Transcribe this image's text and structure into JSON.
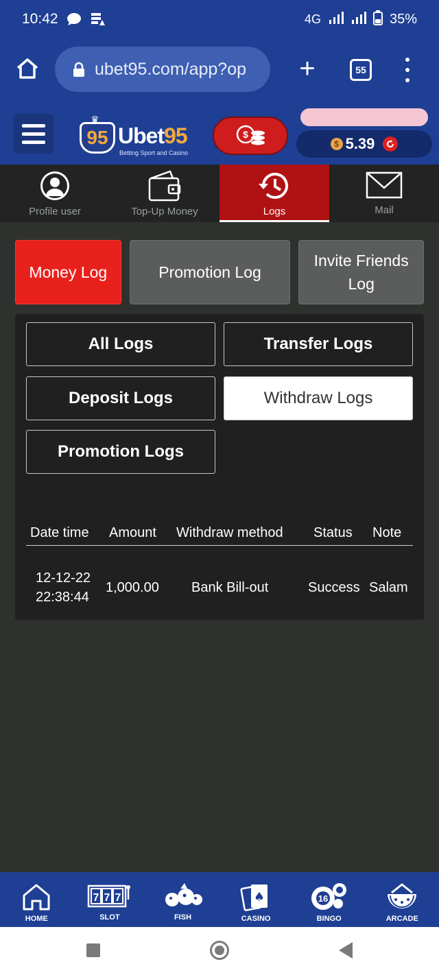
{
  "status_bar": {
    "time": "10:42",
    "network": "4G",
    "battery": "35%"
  },
  "browser": {
    "url": "ubet95.com/app?op",
    "tab_count": "55"
  },
  "header": {
    "logo_badge": "95",
    "logo_name_a": "Ubet",
    "logo_name_b": "95",
    "logo_tagline": "Betting Sport and Casino",
    "balance": "5.39",
    "currency_symbol": "$"
  },
  "account_nav": [
    {
      "label": "Profile user",
      "icon": "profile-icon"
    },
    {
      "label": "Top-Up Money",
      "icon": "wallet-icon"
    },
    {
      "label": "Logs",
      "icon": "history-icon",
      "active": true
    },
    {
      "label": "Mail",
      "icon": "mail-icon"
    }
  ],
  "log_types": [
    {
      "label": "Money Log",
      "active": true
    },
    {
      "label": "Promotion Log"
    },
    {
      "label": "Invite Friends Log"
    }
  ],
  "filters": [
    {
      "label": "All Logs"
    },
    {
      "label": "Transfer Logs"
    },
    {
      "label": "Deposit Logs"
    },
    {
      "label": "Withdraw Logs",
      "active": true
    },
    {
      "label": "Promotion Logs"
    }
  ],
  "table": {
    "columns": [
      "Date time",
      "Amount",
      "Withdraw method",
      "Status",
      "Note"
    ],
    "rows": [
      {
        "date": "12-12-22",
        "time": "22:38:44",
        "amount": "1,000.00",
        "method": "Bank Bill-out",
        "status": "Success",
        "note": "Salam"
      }
    ]
  },
  "bottom_nav": [
    {
      "label": "HOME",
      "icon": "home-icon"
    },
    {
      "label": "SLOT",
      "icon": "slot-icon"
    },
    {
      "label": "FISH",
      "icon": "fish-icon"
    },
    {
      "label": "CASINO",
      "icon": "cards-icon"
    },
    {
      "label": "BINGO",
      "icon": "bingo-icon"
    },
    {
      "label": "ARCADE",
      "icon": "arcade-icon"
    }
  ],
  "colors": {
    "brand_blue": "#1f3f94",
    "active_red": "#e9211c",
    "gold": "#f2a93b"
  }
}
